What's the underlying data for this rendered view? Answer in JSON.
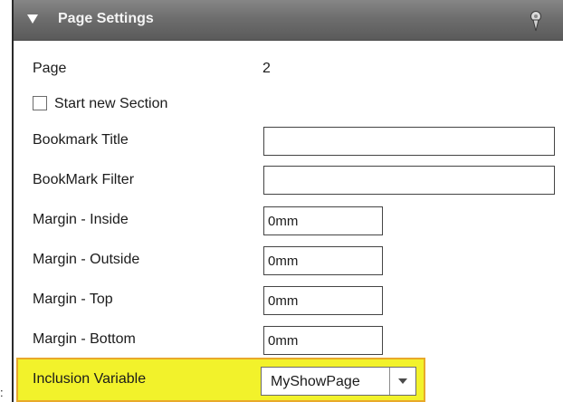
{
  "edge_mark": ":",
  "header": {
    "title": "Page Settings",
    "collapse_icon": "triangle-down-icon",
    "pin_icon": "map-pin-icon"
  },
  "page": {
    "label": "Page",
    "value": "2"
  },
  "start_new_section": {
    "label": "Start new Section",
    "checked": false
  },
  "bookmark_title": {
    "label": "Bookmark Title",
    "value": ""
  },
  "bookmark_filter": {
    "label": "BookMark Filter",
    "value": ""
  },
  "margin_inside": {
    "label": "Margin - Inside",
    "value": "0mm"
  },
  "margin_outside": {
    "label": "Margin - Outside",
    "value": "0mm"
  },
  "margin_top": {
    "label": "Margin - Top",
    "value": "0mm"
  },
  "margin_bottom": {
    "label": "Margin - Bottom",
    "value": "0mm"
  },
  "inclusion_variable": {
    "label": "Inclusion Variable",
    "value": "MyShowPage",
    "highlight_color": "#f2f22b"
  }
}
